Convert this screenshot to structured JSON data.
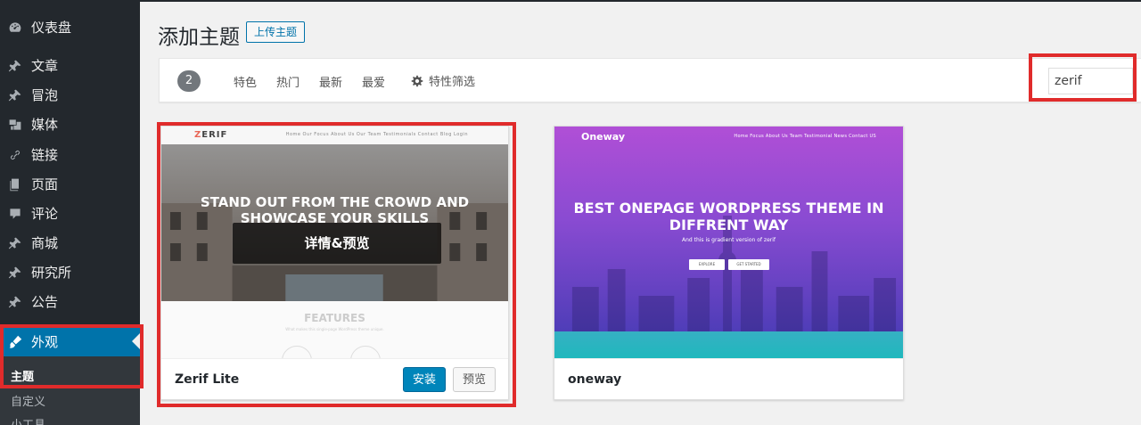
{
  "sidebar": {
    "items": [
      {
        "label": "仪表盘",
        "icon": "dashboard-icon"
      },
      {
        "label": "文章",
        "icon": "pin-icon"
      },
      {
        "label": "冒泡",
        "icon": "pin-icon"
      },
      {
        "label": "媒体",
        "icon": "media-icon"
      },
      {
        "label": "链接",
        "icon": "link-icon"
      },
      {
        "label": "页面",
        "icon": "page-icon"
      },
      {
        "label": "评论",
        "icon": "comment-icon"
      },
      {
        "label": "商城",
        "icon": "pin-icon"
      },
      {
        "label": "研究所",
        "icon": "pin-icon"
      },
      {
        "label": "公告",
        "icon": "pin-icon"
      }
    ],
    "active": {
      "label": "外观",
      "icon": "brush-icon"
    },
    "submenu": [
      {
        "label": "主题",
        "current": true
      },
      {
        "label": "自定义",
        "current": false
      },
      {
        "label": "小工具",
        "current": false
      }
    ]
  },
  "header": {
    "title": "添加主题",
    "upload_label": "上传主题"
  },
  "filter": {
    "count": "2",
    "tabs": [
      "特色",
      "热门",
      "最新",
      "最爱"
    ],
    "feature_filter": "特性筛选",
    "search_value": "zerif"
  },
  "themes": [
    {
      "name": "Zerif Lite",
      "install_label": "安装",
      "preview_label": "预览",
      "overlay_label": "详情&预览",
      "shot": {
        "logo_initial": "Z",
        "logo_rest": "ERIF",
        "nav": "Home   Our Focus   About Us   Our Team   Testimonials   Contact   Blog   Login",
        "headline_1": "STAND OUT FROM THE CROWD AND",
        "headline_2": "SHOWCASE YOUR SKILLS",
        "features_title": "FEATURES",
        "features_sub": "What makes this single-page WordPress theme unique."
      }
    },
    {
      "name": "oneway",
      "shot": {
        "logo": "Oneway",
        "nav": "Home   Focus   About Us   Team   Testimonial   News   Contact US",
        "headline_1": "BEST ONEPAGE WORDPRESS THEME IN",
        "headline_2": "DIFFRENT WAY",
        "subline": "And this is gradient version of zerif",
        "btn_1": "EXPLORE",
        "btn_2": "GET STARTED"
      }
    }
  ],
  "colors": {
    "sidebar_bg": "#23282d",
    "active_bg": "#0073aa",
    "highlight_red": "#e02b2b",
    "install_blue": "#0085ba"
  }
}
